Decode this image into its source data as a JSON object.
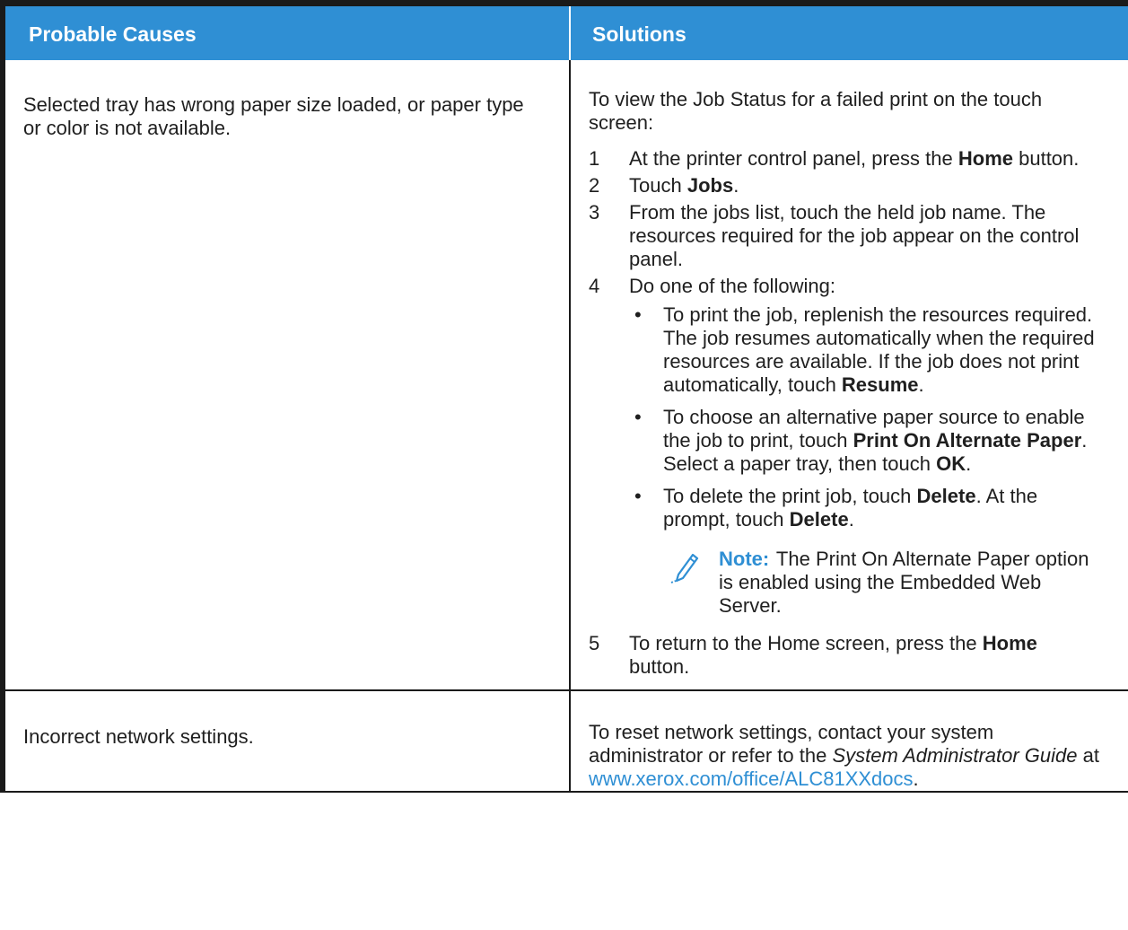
{
  "header": {
    "causes": "Probable Causes",
    "solutions": "Solutions"
  },
  "row1": {
    "cause": "Selected tray has wrong paper size loaded, or paper type or color is not available.",
    "intro": "To view the Job Status for a failed print on the touch screen:",
    "step1": {
      "num": "1",
      "a": "At the printer control panel, press the ",
      "b": "Home",
      "c": " button."
    },
    "step2": {
      "num": "2",
      "a": "Touch ",
      "b": "Jobs",
      "c": "."
    },
    "step3": {
      "num": "3",
      "a": "From the jobs list, touch the held job name. The resources required for the job appear on the control panel."
    },
    "step4": {
      "num": "4",
      "a": "Do one of the following:"
    },
    "bullet1": {
      "a": "To print the job, replenish the resources required. The job resumes automatically when the required resources are available. If the job does not print automatically, touch ",
      "b": "Resume",
      "c": "."
    },
    "bullet2": {
      "a": "To choose an alternative paper source to enable the job to print, touch ",
      "b": "Print On Alternate Paper",
      "c": ". Select a paper tray, then touch ",
      "d": "OK",
      "e": "."
    },
    "bullet3": {
      "a": "To delete the print job, touch ",
      "b": "Delete",
      "c": ". At the prompt, touch ",
      "d": "Delete",
      "e": "."
    },
    "note": {
      "icon": "pencil-icon",
      "label": "Note:",
      "text": " The Print On Alternate Paper option is enabled using the Embedded Web Server."
    },
    "step5": {
      "num": "5",
      "a": "To return to the Home screen, press the ",
      "b": "Home",
      "c": " button."
    }
  },
  "row2": {
    "cause": "Incorrect network settings.",
    "a": "To reset network settings, contact your system administrator or refer to the ",
    "guide": "System Administrator Guide",
    "b": " at ",
    "url": "www.xerox.com/office/ALC81XXdocs",
    "c": "."
  },
  "colors": {
    "header_bg": "#2f8fd4",
    "link": "#2f8fd4",
    "note_label": "#2f8fd4"
  }
}
